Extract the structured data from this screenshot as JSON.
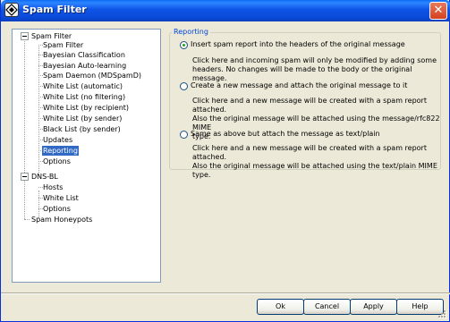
{
  "window": {
    "title": "Spam Filter"
  },
  "tree": {
    "items": [
      {
        "label": "Spam Filter"
      },
      {
        "label": "Spam Filter"
      },
      {
        "label": "Bayesian Classification"
      },
      {
        "label": "Bayesian Auto-learning"
      },
      {
        "label": "Spam Daemon (MDSpamD)"
      },
      {
        "label": "White List (automatic)"
      },
      {
        "label": "White List (no filtering)"
      },
      {
        "label": "White List (by recipient)"
      },
      {
        "label": "White List (by sender)"
      },
      {
        "label": "Black List (by sender)"
      },
      {
        "label": "Updates"
      },
      {
        "label": "Reporting",
        "selected": true
      },
      {
        "label": "Options"
      },
      {
        "label": "DNS-BL"
      },
      {
        "label": "Hosts"
      },
      {
        "label": "White List"
      },
      {
        "label": "Options"
      },
      {
        "label": "Spam Honeypots"
      }
    ]
  },
  "reporting": {
    "group_title": "Reporting",
    "options": [
      {
        "label": "Insert spam report into the headers of the original message",
        "checked": true,
        "desc1": "Click here and incoming spam will only be modified by adding some",
        "desc2": "headers.  No changes will be made to the body or the original message."
      },
      {
        "label": "Create a new message and attach the original message to it",
        "checked": false,
        "desc1": "Click here and a new message will be created with a spam report attached.",
        "desc2": "Also the original message will be attached using the message/rfc822 MIME",
        "desc3": "type."
      },
      {
        "label": "Same as above but attach the message as text/plain",
        "checked": false,
        "desc1": "Click here and a new message will be created with a spam report attached.",
        "desc2": "Also the original message will be attached using the text/plain MIME type."
      }
    ]
  },
  "buttons": {
    "ok": "Ok",
    "cancel": "Cancel",
    "apply": "Apply",
    "help": "Help"
  }
}
